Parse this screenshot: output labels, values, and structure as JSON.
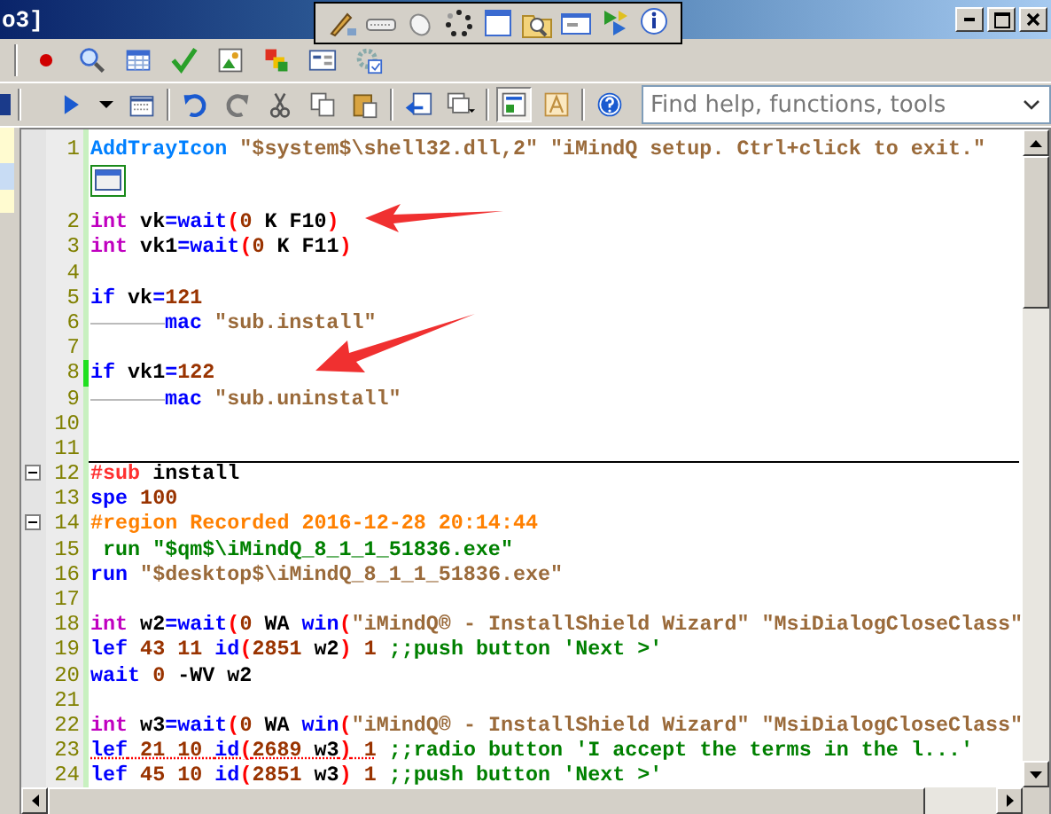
{
  "window": {
    "title": "o3]"
  },
  "floating_toolbar": [
    {
      "kind": "pencil"
    },
    {
      "kind": "keyboard"
    },
    {
      "kind": "mouse"
    },
    {
      "kind": "spinner"
    },
    {
      "kind": "window"
    },
    {
      "kind": "findfolder"
    },
    {
      "kind": "dialog"
    },
    {
      "kind": "play"
    },
    {
      "kind": "info"
    }
  ],
  "toolbar_top": [
    {
      "kind": "record"
    },
    {
      "kind": "magnifier"
    },
    {
      "kind": "table"
    },
    {
      "kind": "check"
    },
    {
      "kind": "image"
    },
    {
      "kind": "squares"
    },
    {
      "kind": "form"
    },
    {
      "kind": "gear"
    }
  ],
  "toolbar_main": [
    {
      "kind": "run",
      "pressed": false
    },
    {
      "kind": "caret",
      "pressed": false
    },
    {
      "kind": "calendar",
      "pressed": false
    },
    {
      "kind": "sep"
    },
    {
      "kind": "undo",
      "pressed": false
    },
    {
      "kind": "redo",
      "pressed": false
    },
    {
      "kind": "cut",
      "pressed": false
    },
    {
      "kind": "copy",
      "pressed": false
    },
    {
      "kind": "paste",
      "pressed": false
    },
    {
      "kind": "sep"
    },
    {
      "kind": "import",
      "pressed": false
    },
    {
      "kind": "windows",
      "pressed": false
    },
    {
      "kind": "sep"
    },
    {
      "kind": "code",
      "pressed": true
    },
    {
      "kind": "font",
      "pressed": false
    },
    {
      "kind": "sep"
    },
    {
      "kind": "help",
      "pressed": false
    }
  ],
  "search": {
    "placeholder": "Find help, functions, tools"
  },
  "editor": {
    "lines": [
      {
        "number": "1",
        "fold": false,
        "modified": false,
        "divider": false,
        "embedded_icon": true,
        "tokens": [
          {
            "kind": "function",
            "text": "AddTrayIcon"
          },
          {
            "kind": "string",
            "text": " \"$system$\\shell32.dll,2\""
          },
          {
            "kind": "string",
            "text": " \"iMindQ setup. Ctrl+click to exit.\""
          }
        ]
      },
      {
        "number": "2",
        "fold": false,
        "modified": false,
        "divider": false,
        "embedded_icon": false,
        "tokens": [
          {
            "kind": "type",
            "text": "int"
          },
          {
            "kind": "plain",
            "text": " vk"
          },
          {
            "kind": "operator",
            "text": "="
          },
          {
            "kind": "keyword",
            "text": "wait"
          },
          {
            "kind": "paren",
            "text": "("
          },
          {
            "kind": "number",
            "text": "0"
          },
          {
            "kind": "plain",
            "text": " K F10"
          },
          {
            "kind": "paren",
            "text": ")"
          }
        ]
      },
      {
        "number": "3",
        "fold": false,
        "modified": false,
        "divider": false,
        "embedded_icon": false,
        "tokens": [
          {
            "kind": "type",
            "text": "int"
          },
          {
            "kind": "plain",
            "text": " vk1"
          },
          {
            "kind": "operator",
            "text": "="
          },
          {
            "kind": "keyword",
            "text": "wait"
          },
          {
            "kind": "paren",
            "text": "("
          },
          {
            "kind": "number",
            "text": "0"
          },
          {
            "kind": "plain",
            "text": " K F11"
          },
          {
            "kind": "paren",
            "text": ")"
          }
        ]
      },
      {
        "number": "4",
        "fold": false,
        "modified": false,
        "divider": false,
        "embedded_icon": false
      },
      {
        "number": "5",
        "fold": false,
        "modified": false,
        "divider": false,
        "embedded_icon": false,
        "tokens": [
          {
            "kind": "keyword",
            "text": "if"
          },
          {
            "kind": "plain",
            "text": " vk"
          },
          {
            "kind": "operator",
            "text": "="
          },
          {
            "kind": "number",
            "text": "121"
          }
        ]
      },
      {
        "number": "6",
        "fold": false,
        "modified": false,
        "divider": false,
        "embedded_icon": false,
        "tokens": [
          {
            "kind": "tab"
          },
          {
            "kind": "keyword",
            "text": "mac"
          },
          {
            "kind": "string",
            "text": " \"sub.install\""
          }
        ]
      },
      {
        "number": "7",
        "fold": false,
        "modified": false,
        "divider": false,
        "embedded_icon": false
      },
      {
        "number": "8",
        "fold": false,
        "modified": true,
        "divider": false,
        "embedded_icon": false,
        "tokens": [
          {
            "kind": "keyword",
            "text": "if"
          },
          {
            "kind": "plain",
            "text": " vk1"
          },
          {
            "kind": "operator",
            "text": "="
          },
          {
            "kind": "number",
            "text": "122"
          }
        ]
      },
      {
        "number": "9",
        "fold": false,
        "modified": false,
        "divider": false,
        "embedded_icon": false,
        "tokens": [
          {
            "kind": "tab"
          },
          {
            "kind": "keyword",
            "text": "mac"
          },
          {
            "kind": "string",
            "text": " \"sub.uninstall\""
          }
        ]
      },
      {
        "number": "10",
        "fold": false,
        "modified": false,
        "divider": false,
        "embedded_icon": false
      },
      {
        "number": "11",
        "fold": false,
        "modified": false,
        "divider": false,
        "embedded_icon": false
      },
      {
        "number": "12",
        "fold": true,
        "modified": false,
        "divider": true,
        "embedded_icon": false,
        "tokens": [
          {
            "kind": "sub",
            "text": "#sub"
          },
          {
            "kind": "plain",
            "text": " install"
          }
        ]
      },
      {
        "number": "13",
        "fold": false,
        "modified": false,
        "divider": false,
        "embedded_icon": false,
        "tokens": [
          {
            "kind": "keyword",
            "text": "spe"
          },
          {
            "kind": "number",
            "text": " 100"
          }
        ]
      },
      {
        "number": "14",
        "fold": true,
        "modified": false,
        "divider": false,
        "embedded_icon": false,
        "tokens": [
          {
            "kind": "region",
            "text": "#region Recorded 2016-12-28 20:14:44"
          }
        ]
      },
      {
        "number": "15",
        "fold": false,
        "modified": false,
        "divider": false,
        "embedded_icon": false,
        "tokens": [
          {
            "kind": "comment",
            "text": " run \"$qm$\\iMindQ_8_1_1_51836.exe\""
          }
        ]
      },
      {
        "number": "16",
        "fold": false,
        "modified": false,
        "divider": false,
        "embedded_icon": false,
        "tokens": [
          {
            "kind": "keyword",
            "text": "run"
          },
          {
            "kind": "string",
            "text": " \"$desktop$\\iMindQ_8_1_1_51836.exe\""
          }
        ]
      },
      {
        "number": "17",
        "fold": false,
        "modified": false,
        "divider": false,
        "embedded_icon": false
      },
      {
        "number": "18",
        "fold": false,
        "modified": false,
        "divider": false,
        "embedded_icon": false,
        "tokens": [
          {
            "kind": "type",
            "text": "int"
          },
          {
            "kind": "plain",
            "text": " w2"
          },
          {
            "kind": "operator",
            "text": "="
          },
          {
            "kind": "keyword",
            "text": "wait"
          },
          {
            "kind": "paren",
            "text": "("
          },
          {
            "kind": "number",
            "text": "0"
          },
          {
            "kind": "plain",
            "text": " WA "
          },
          {
            "kind": "keyword",
            "text": "win"
          },
          {
            "kind": "paren",
            "text": "("
          },
          {
            "kind": "string",
            "text": "\"iMindQ® - InstallShield Wizard\""
          },
          {
            "kind": "string",
            "text": " \"MsiDialogCloseClass\""
          }
        ]
      },
      {
        "number": "19",
        "fold": false,
        "modified": false,
        "divider": false,
        "embedded_icon": false,
        "tokens": [
          {
            "kind": "keyword",
            "text": "lef"
          },
          {
            "kind": "number",
            "text": " 43 11 "
          },
          {
            "kind": "keyword",
            "text": "id"
          },
          {
            "kind": "paren",
            "text": "("
          },
          {
            "kind": "number",
            "text": "2851"
          },
          {
            "kind": "plain",
            "text": " w2"
          },
          {
            "kind": "paren",
            "text": ")"
          },
          {
            "kind": "number",
            "text": " 1 "
          },
          {
            "kind": "comment",
            "text": ";;push button 'Next >'"
          }
        ]
      },
      {
        "number": "20",
        "fold": false,
        "modified": false,
        "divider": false,
        "embedded_icon": false,
        "tokens": [
          {
            "kind": "keyword",
            "text": "wait"
          },
          {
            "kind": "number",
            "text": " 0"
          },
          {
            "kind": "plain",
            "text": " -WV w2"
          }
        ]
      },
      {
        "number": "21",
        "fold": false,
        "modified": false,
        "divider": false,
        "embedded_icon": false
      },
      {
        "number": "22",
        "fold": false,
        "modified": false,
        "divider": false,
        "embedded_icon": false,
        "tokens": [
          {
            "kind": "type",
            "text": "int"
          },
          {
            "kind": "plain",
            "text": " w3"
          },
          {
            "kind": "operator",
            "text": "="
          },
          {
            "kind": "keyword",
            "text": "wait"
          },
          {
            "kind": "paren",
            "text": "("
          },
          {
            "kind": "number",
            "text": "0"
          },
          {
            "kind": "plain",
            "text": " WA "
          },
          {
            "kind": "keyword",
            "text": "win"
          },
          {
            "kind": "paren",
            "text": "("
          },
          {
            "kind": "string",
            "text": "\"iMindQ® - InstallShield Wizard\""
          },
          {
            "kind": "string",
            "text": " \"MsiDialogCloseClass\""
          }
        ]
      },
      {
        "number": "23",
        "fold": false,
        "modified": false,
        "divider": false,
        "embedded_icon": false,
        "tokens": [
          {
            "kind": "keyword",
            "text": "lef",
            "flagged": true
          },
          {
            "kind": "number",
            "text": " 21 10 ",
            "flagged": true
          },
          {
            "kind": "keyword",
            "text": "id",
            "flagged": true
          },
          {
            "kind": "paren",
            "text": "(",
            "flagged": true
          },
          {
            "kind": "number",
            "text": "2689",
            "flagged": true
          },
          {
            "kind": "plain",
            "text": " w3",
            "flagged": true
          },
          {
            "kind": "paren",
            "text": ")",
            "flagged": true
          },
          {
            "kind": "number",
            "text": " 1",
            "flagged": true
          },
          {
            "kind": "comment",
            "text": " ;;radio button 'I accept the terms in the l...'"
          }
        ]
      },
      {
        "number": "24",
        "fold": false,
        "modified": false,
        "divider": false,
        "embedded_icon": false,
        "tokens": [
          {
            "kind": "keyword",
            "text": "lef"
          },
          {
            "kind": "number",
            "text": " 45 10 "
          },
          {
            "kind": "keyword",
            "text": "id"
          },
          {
            "kind": "paren",
            "text": "("
          },
          {
            "kind": "number",
            "text": "2851"
          },
          {
            "kind": "plain",
            "text": " w3"
          },
          {
            "kind": "paren",
            "text": ")"
          },
          {
            "kind": "number",
            "text": " 1 "
          },
          {
            "kind": "comment",
            "text": ";;push button 'Next >'"
          }
        ]
      }
    ]
  }
}
